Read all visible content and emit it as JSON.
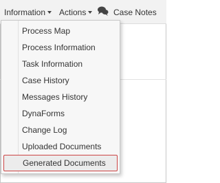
{
  "toolbar": {
    "information_label": "Information",
    "actions_label": "Actions",
    "case_notes_label": "Case Notes",
    "case_notes_icon": "chat-bubbles-icon"
  },
  "menu": {
    "items": [
      {
        "label": "Process Map"
      },
      {
        "label": "Process Information"
      },
      {
        "label": "Task Information"
      },
      {
        "label": "Case History"
      },
      {
        "label": "Messages History"
      },
      {
        "label": "DynaForms"
      },
      {
        "label": "Change Log"
      },
      {
        "label": "Uploaded Documents"
      },
      {
        "label": "Generated Documents"
      }
    ],
    "highlighted_item": "Generated Documents",
    "highlight_color": "#cc4444"
  }
}
